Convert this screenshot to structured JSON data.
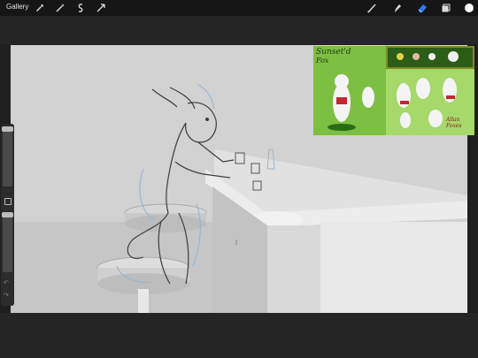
{
  "topbar": {
    "gallery_label": "Gallery",
    "left_tools": [
      "wrench-icon",
      "magic-wand-icon",
      "selection-icon",
      "transform-icon"
    ],
    "right_tools": [
      "brush-icon",
      "smudge-icon",
      "eraser-icon",
      "layers-icon",
      "color-swatch-icon"
    ],
    "active_tool": "eraser-icon",
    "accent_color": "#2f7bf5",
    "current_color": "#ffffff"
  },
  "sidebar": {
    "brush_size_slider": 0.6,
    "opacity_slider": 0.0
  },
  "reference": {
    "title_line1": "Sunset'd",
    "title_line2": "Fox",
    "signature": "Allan Foxes"
  }
}
